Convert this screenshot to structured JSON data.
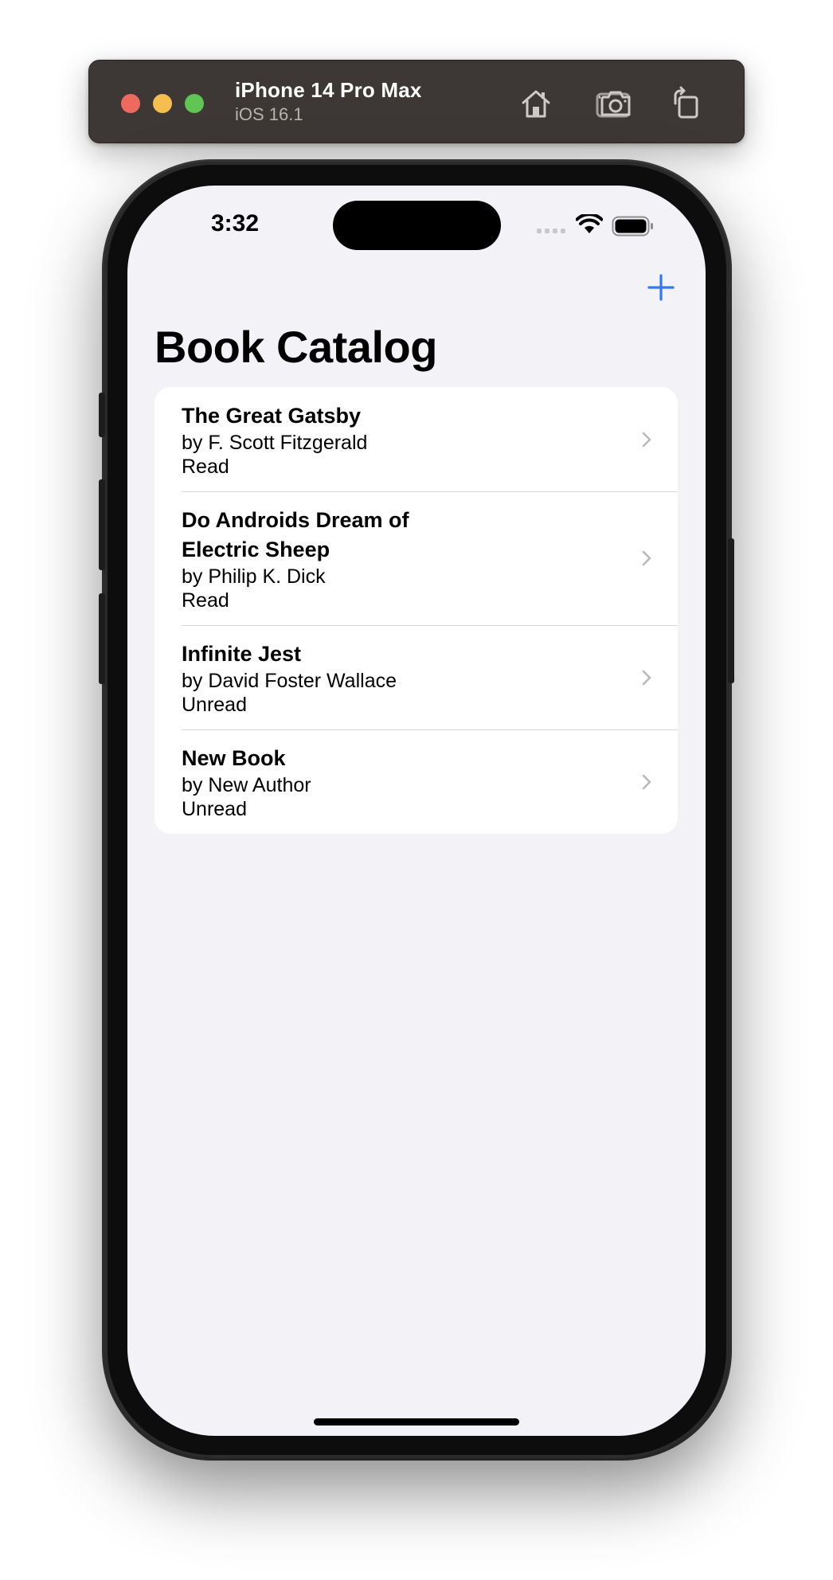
{
  "simulator": {
    "device_name": "iPhone 14 Pro Max",
    "os_version": "iOS 16.1",
    "tools": {
      "home_icon": "home-icon",
      "screenshot_icon": "camera-icon",
      "rotate_icon": "rotate-icon"
    }
  },
  "status_bar": {
    "time": "3:32"
  },
  "nav": {
    "title": "Book Catalog",
    "add_icon": "plus-icon",
    "accent_color": "#3478f6"
  },
  "books": [
    {
      "title": "The Great Gatsby",
      "author": "by F. Scott Fitzgerald",
      "status": "Read"
    },
    {
      "title": "Do Androids Dream of Electric Sheep",
      "author": "by Philip K. Dick",
      "status": "Read"
    },
    {
      "title": "Infinite Jest",
      "author": "by David Foster Wallace",
      "status": "Unread"
    },
    {
      "title": "New Book",
      "author": "by New Author",
      "status": "Unread"
    }
  ]
}
